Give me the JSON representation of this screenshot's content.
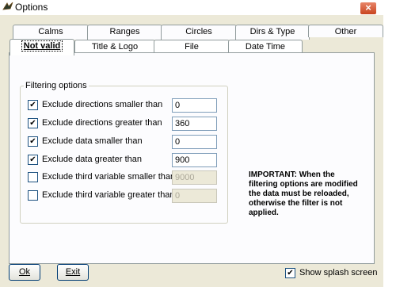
{
  "window": {
    "title": "Options",
    "close_label": "×"
  },
  "tabs_back": [
    "Calms",
    "Ranges",
    "Circles",
    "Dirs & Type",
    "Other"
  ],
  "tabs_front": [
    "Not valid",
    "Title & Logo",
    "File",
    "Date Time"
  ],
  "active_tab": "Not valid",
  "filtering": {
    "legend": "Filtering options",
    "rows": [
      {
        "label": "Exclude directions smaller than",
        "checked": true,
        "value": "0",
        "enabled": true
      },
      {
        "label": "Exclude directions greater than",
        "checked": true,
        "value": "360",
        "enabled": true
      },
      {
        "label": "Exclude data smaller than",
        "checked": true,
        "value": "0",
        "enabled": true
      },
      {
        "label": "Exclude data greater than",
        "checked": true,
        "value": "900",
        "enabled": true
      },
      {
        "label": "Exclude third variable smaller than",
        "checked": false,
        "value": "9000",
        "enabled": false
      },
      {
        "label": "Exclude third variable greater than",
        "checked": false,
        "value": "0",
        "enabled": false
      }
    ]
  },
  "notice": "IMPORTANT: When the filtering options are modified the data must be reloaded, otherwise the filter is not applied.",
  "buttons": {
    "ok": "Ok",
    "exit": "Exit"
  },
  "splash": {
    "label": "Show splash screen",
    "checked": true
  },
  "colors": {
    "dialog_bg": "#ece9d8",
    "panel_bg": "#fcfcfe",
    "close_red": "#c8441f"
  }
}
